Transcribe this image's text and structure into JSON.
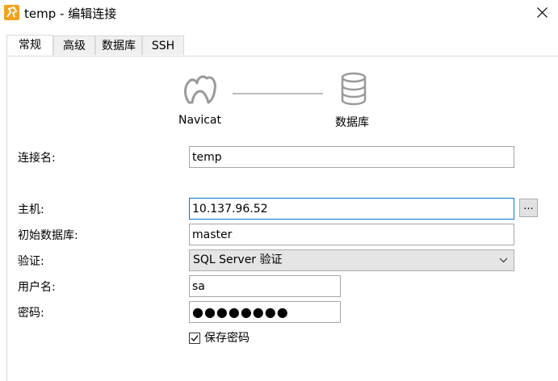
{
  "window": {
    "title": "temp - 编辑连接",
    "app_icon": "navicat-app-icon",
    "close_icon": "close-icon"
  },
  "tabs": [
    {
      "label": "常规",
      "active": true
    },
    {
      "label": "高级",
      "active": false
    },
    {
      "label": "数据库",
      "active": false
    },
    {
      "label": "SSH",
      "active": false
    }
  ],
  "diagram": {
    "left_label": "Navicat",
    "right_label": "数据库",
    "left_icon": "navicat-icon",
    "right_icon": "database-icon"
  },
  "form": {
    "connection_name": {
      "label": "连接名:",
      "value": "temp"
    },
    "host": {
      "label": "主机:",
      "value": "10.137.96.52",
      "more_label": "..."
    },
    "initial_database": {
      "label": "初始数据库:",
      "value": "master"
    },
    "auth": {
      "label": "验证:",
      "value": "SQL Server 验证"
    },
    "username": {
      "label": "用户名:",
      "value": "sa"
    },
    "password": {
      "label": "密码:",
      "masked": "●●●●●●●●"
    },
    "save_password": {
      "label": "保存密码",
      "checked": true
    }
  }
}
